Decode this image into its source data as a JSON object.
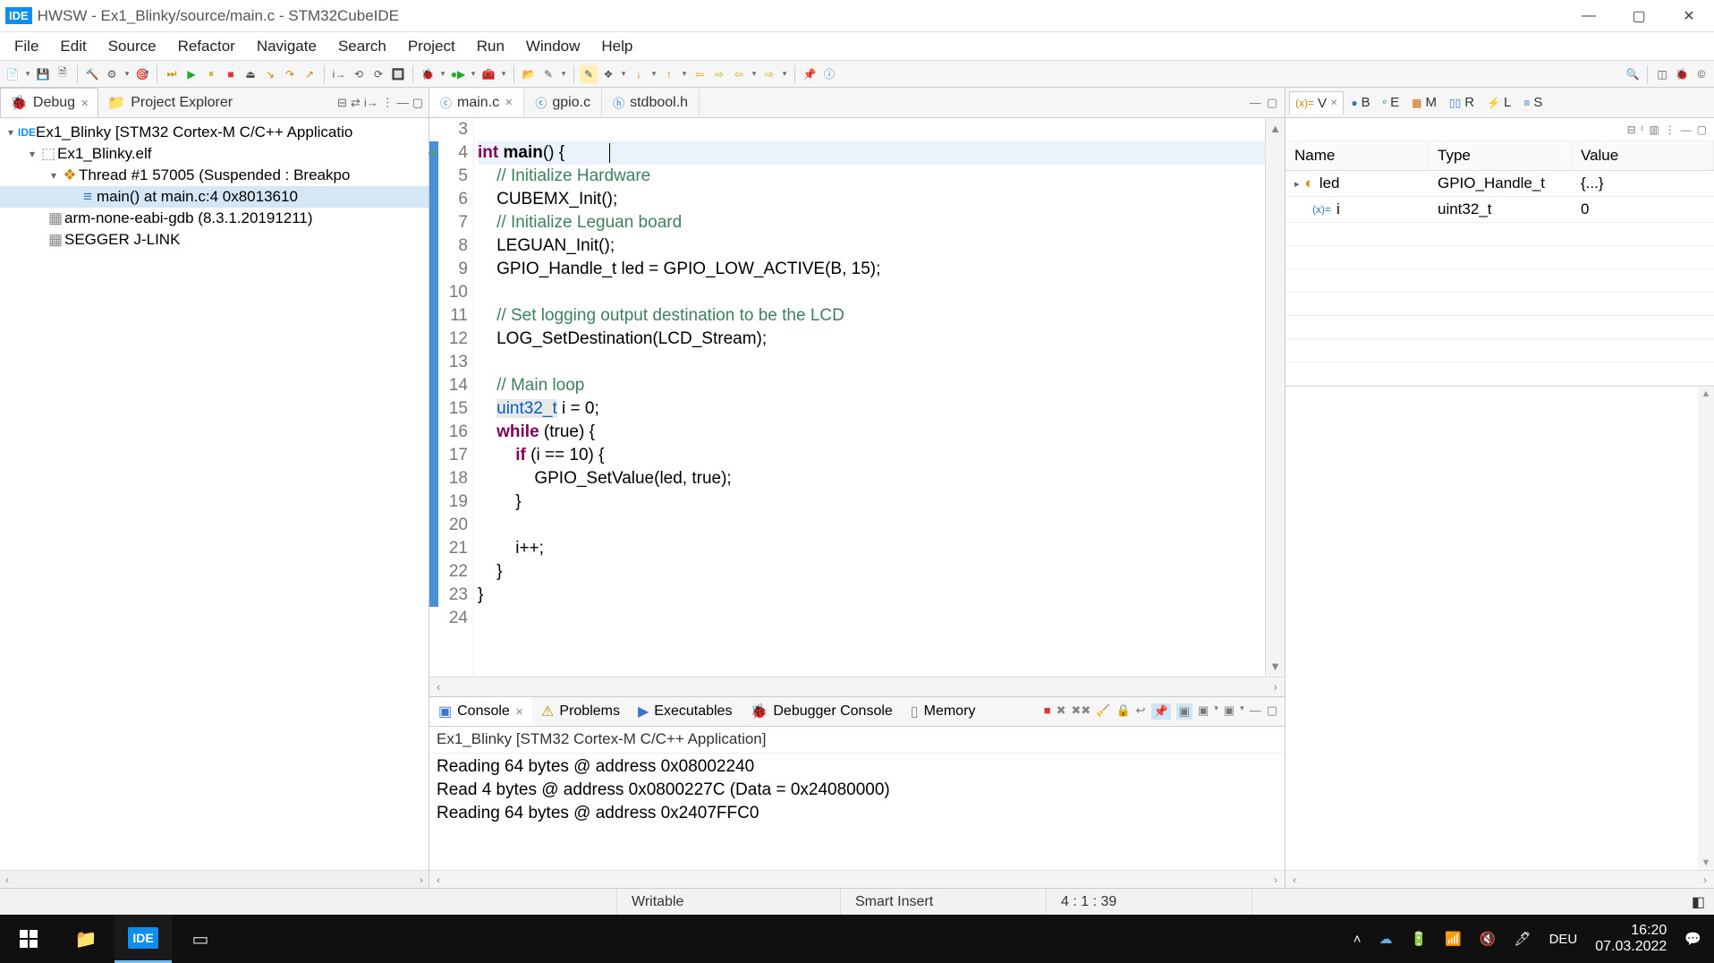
{
  "window": {
    "ide_badge": "IDE",
    "title": "HWSW - Ex1_Blinky/source/main.c - STM32CubeIDE"
  },
  "menu": [
    "File",
    "Edit",
    "Source",
    "Refactor",
    "Navigate",
    "Search",
    "Project",
    "Run",
    "Window",
    "Help"
  ],
  "left": {
    "tabs": {
      "debug": "Debug",
      "project_explorer": "Project Explorer"
    },
    "tree": {
      "n0": "Ex1_Blinky [STM32 Cortex-M C/C++ Applicatio",
      "n1": "Ex1_Blinky.elf",
      "n2": "Thread #1 57005 (Suspended : Breakpo",
      "n3": "main() at main.c:4 0x8013610",
      "n4": "arm-none-eabi-gdb (8.3.1.20191211)",
      "n5": "SEGGER J-LINK"
    }
  },
  "editor": {
    "tabs": {
      "t0": "main.c",
      "t1": "gpio.c",
      "t2": "stdbool.h"
    },
    "lines": {
      "l4a": "int",
      "l4b": " main",
      "l4c": "() {",
      "l5": "    // Initialize Hardware",
      "l6": "    CUBEMX_Init();",
      "l7": "    // Initialize Leguan board",
      "l8": "    LEGUAN_Init();",
      "l9": "    GPIO_Handle_t led = GPIO_LOW_ACTIVE(B, 15);",
      "l10": "",
      "l11": "    // Set logging output destination to be the LCD",
      "l12": "    LOG_SetDestination(LCD_Stream);",
      "l13": "",
      "l14": "    // Main loop",
      "l15a": "    ",
      "l15b": "uint32_t",
      "l15c": " i = 0;",
      "l16a": "    ",
      "l16b": "while",
      "l16c": " (true) {",
      "l17a": "        ",
      "l17b": "if",
      "l17c": " (i == 10) {",
      "l18": "            GPIO_SetValue(led, true);",
      "l19": "        }",
      "l20": "",
      "l21": "        i++;",
      "l22": "    }",
      "l23": "}",
      "l24": ""
    },
    "line_numbers": [
      "3",
      "4",
      "5",
      "6",
      "7",
      "8",
      "9",
      "10",
      "11",
      "12",
      "13",
      "14",
      "15",
      "16",
      "17",
      "18",
      "19",
      "20",
      "21",
      "22",
      "23",
      "24"
    ]
  },
  "right": {
    "tabs": {
      "v": "V",
      "b": "B",
      "e": "E",
      "m": "M",
      "r": "R",
      "l": "L",
      "s": "S"
    },
    "headers": {
      "name": "Name",
      "type": "Type",
      "value": "Value"
    },
    "rows": [
      {
        "name": "led",
        "type": "GPIO_Handle_t",
        "value": "{...}",
        "expandable": true,
        "icon": "struct"
      },
      {
        "name": "i",
        "type": "uint32_t",
        "value": "0",
        "expandable": false,
        "icon": "var"
      }
    ]
  },
  "console": {
    "tabs": {
      "console": "Console",
      "problems": "Problems",
      "executables": "Executables",
      "debugger": "Debugger Console",
      "memory": "Memory"
    },
    "subtitle": "Ex1_Blinky [STM32 Cortex-M C/C++ Application]",
    "lines": [
      "Reading 64 bytes @ address 0x08002240",
      "Read 4 bytes @ address 0x0800227C (Data = 0x24080000)",
      "Reading 64 bytes @ address 0x2407FFC0"
    ]
  },
  "status": {
    "writable": "Writable",
    "insert": "Smart Insert",
    "pos": "4 : 1 : 39"
  },
  "taskbar": {
    "lang": "DEU",
    "time": "16:20",
    "date": "07.03.2022"
  }
}
